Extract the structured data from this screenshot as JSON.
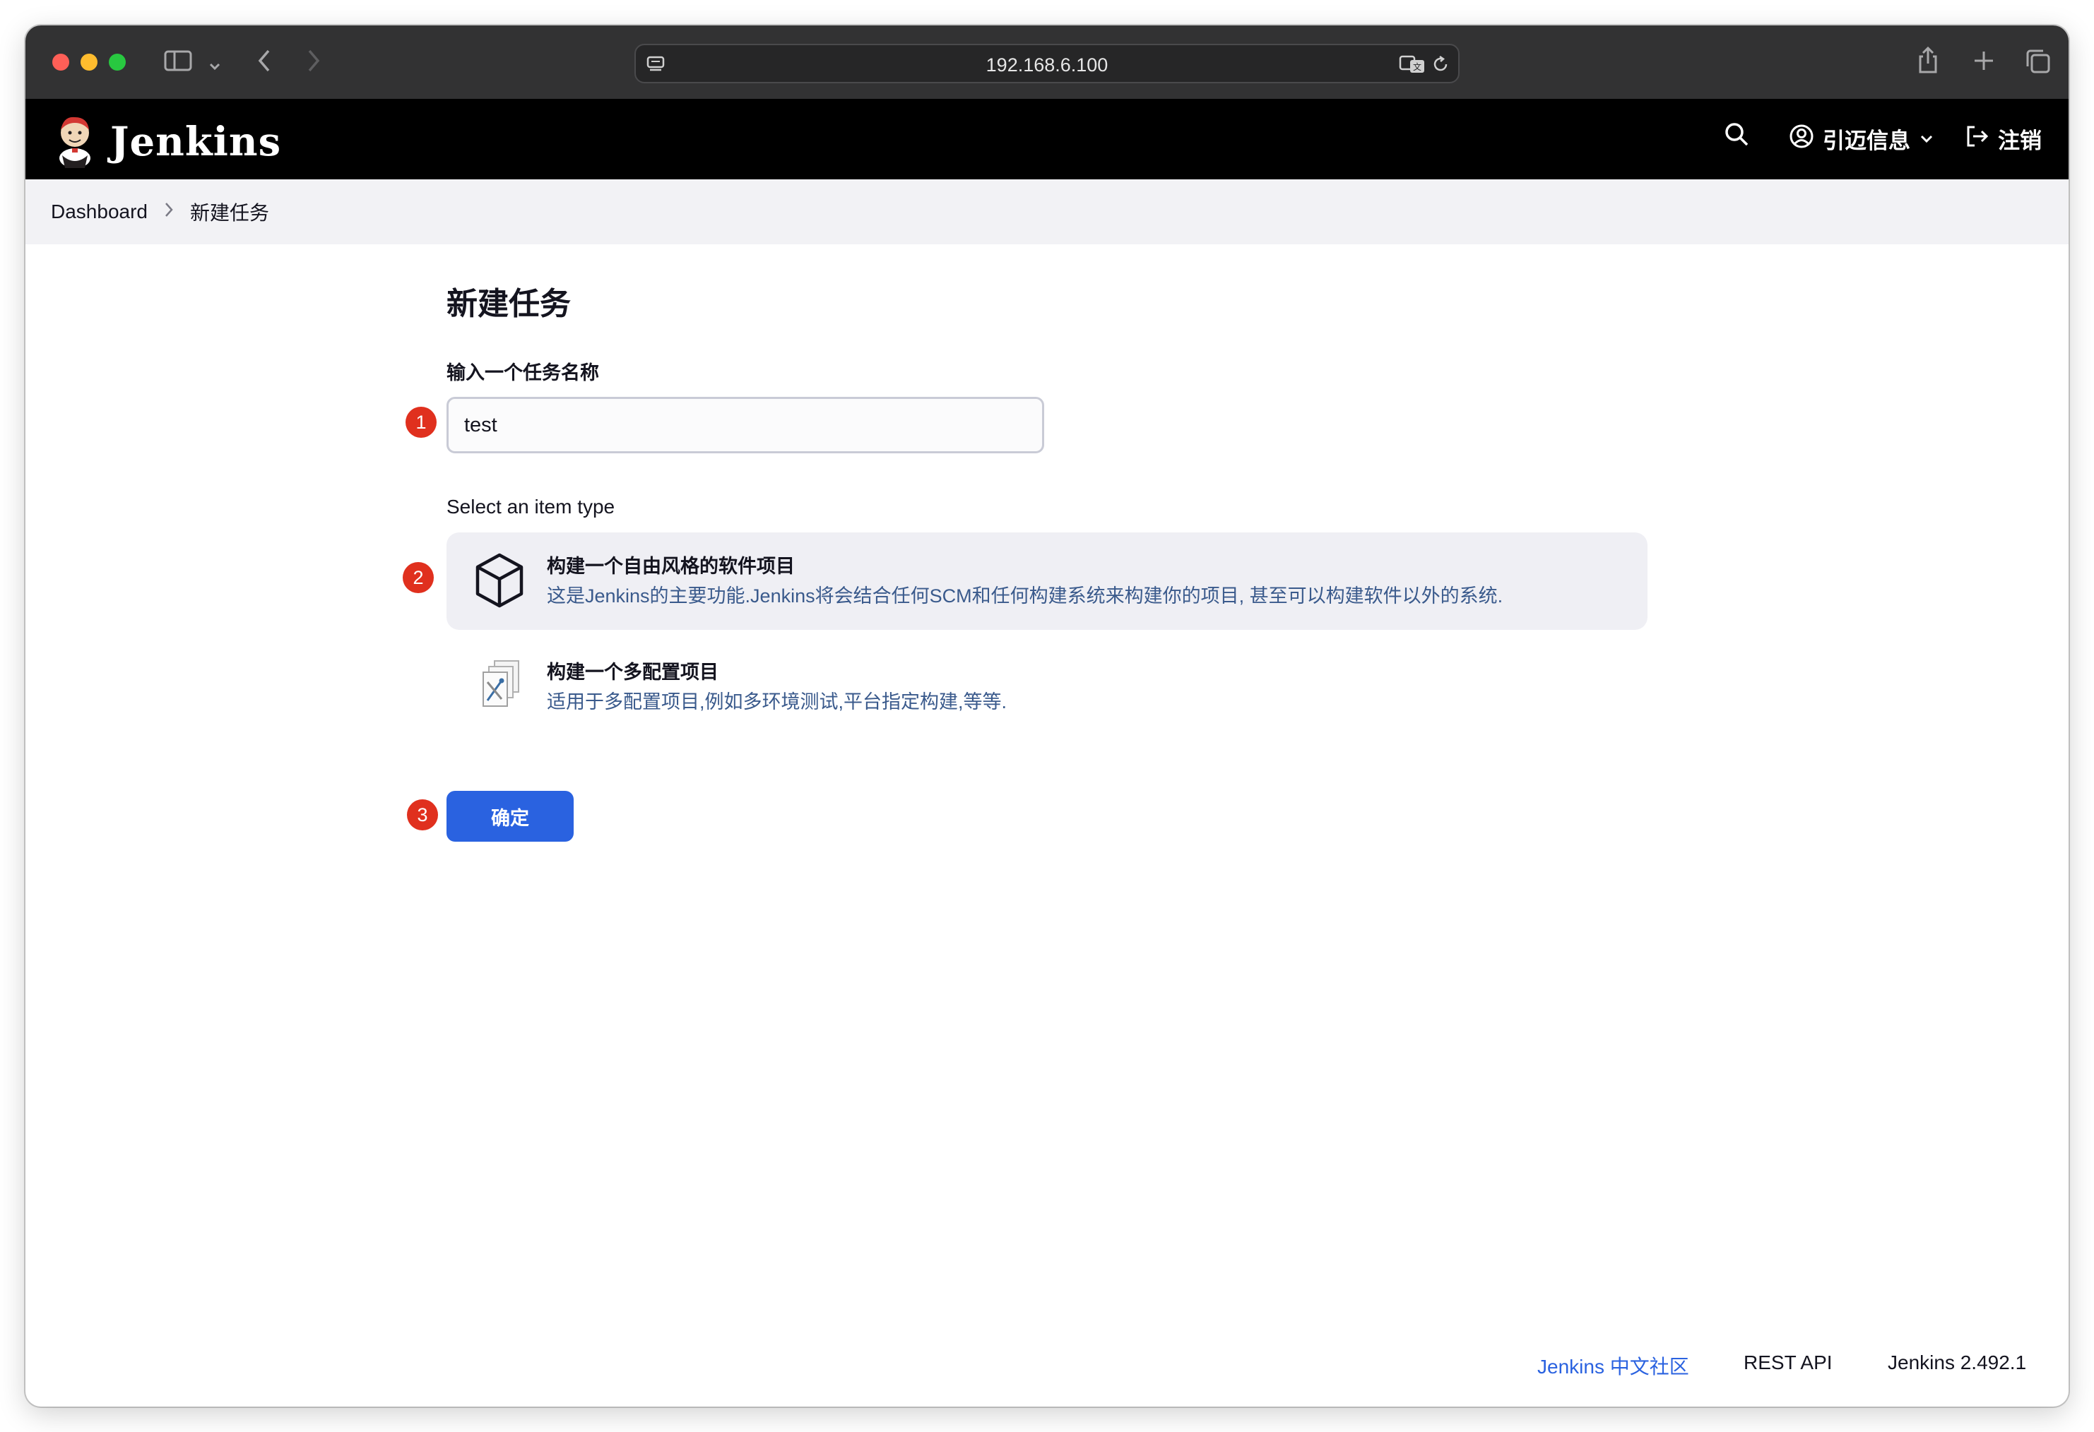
{
  "browser": {
    "url": "192.168.6.100"
  },
  "header": {
    "brand": "Jenkins",
    "user_name": "引迈信息",
    "logout_label": "注销"
  },
  "breadcrumb": {
    "items": [
      "Dashboard",
      "新建任务"
    ]
  },
  "main": {
    "title": "新建任务",
    "name_label": "输入一个任务名称",
    "name_value": "test",
    "select_label": "Select an item type",
    "item_types": [
      {
        "title": "构建一个自由风格的软件项目",
        "description": "这是Jenkins的主要功能.Jenkins将会结合任何SCM和任何构建系统来构建你的项目, 甚至可以构建软件以外的系统.",
        "selected": true,
        "icon": "package-box-icon"
      },
      {
        "title": "构建一个多配置项目",
        "description": "适用于多配置项目,例如多环境测试,平台指定构建,等等.",
        "selected": false,
        "icon": "multi-config-icon"
      }
    ],
    "ok_label": "确定"
  },
  "annotations": [
    "1",
    "2",
    "3"
  ],
  "footer": {
    "community_link": "Jenkins 中文社区",
    "rest_api": "REST API",
    "version": "Jenkins 2.492.1"
  },
  "colors": {
    "accent": "#2a62e0",
    "badge": "#e0301e",
    "header_bg": "#000000",
    "breadcrumb_bg": "#f2f2f5"
  }
}
